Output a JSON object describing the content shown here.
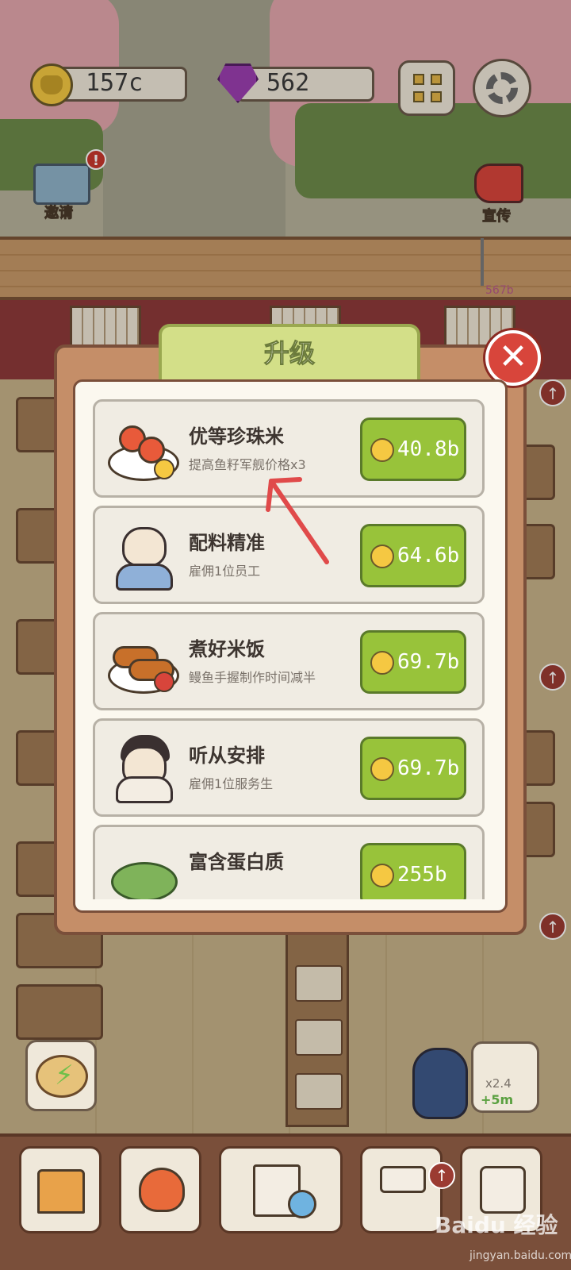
{
  "hud": {
    "coins": "157c",
    "gems": "562",
    "invite_label": "邀请",
    "invite_badge": "!",
    "promo_label": "宣传",
    "fish_value": "567b"
  },
  "modal": {
    "title": "升级",
    "close": "✕",
    "upgrades": [
      {
        "title": "优等珍珠米",
        "desc": "提高鱼籽军舰价格x3",
        "price": "40.8b",
        "icon": "salmon-roe-sushi-icon"
      },
      {
        "title": "配料精准",
        "desc": "雇佣1位员工",
        "price": "64.6b",
        "icon": "chef-cat-icon"
      },
      {
        "title": "煮好米饭",
        "desc": "鳗鱼手握制作时间减半",
        "price": "69.7b",
        "icon": "eel-sushi-icon"
      },
      {
        "title": "听从安排",
        "desc": "雇佣1位服务生",
        "price": "69.7b",
        "icon": "waitress-cat-icon"
      },
      {
        "title": "富含蛋白质",
        "desc": "",
        "price": "255b",
        "icon": "seaweed-salad-icon"
      }
    ]
  },
  "boost": {
    "multiplier": "x2.4",
    "time": "+5m"
  },
  "watermark": {
    "main": "Baidu 经验",
    "sub": "jingyan.baidu.com"
  },
  "colors": {
    "buy_button": "#98c33a",
    "modal_frame": "#c58e68",
    "title_tab": "#d3df88",
    "close_button": "#d8453b",
    "annotation_arrow": "#e04a4a"
  }
}
